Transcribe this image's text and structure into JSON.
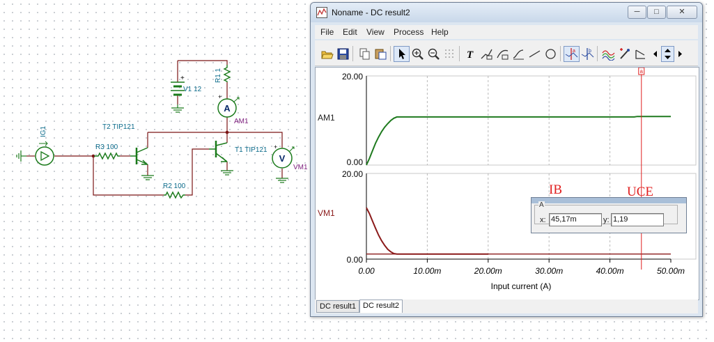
{
  "window": {
    "title": "Noname - DC result2",
    "minimize_glyph": "─",
    "maximize_glyph": "□",
    "close_glyph": "✕"
  },
  "menu": [
    "File",
    "Edit",
    "View",
    "Process",
    "Help"
  ],
  "toolbar_icons": [
    "open-icon",
    "save-icon",
    "copy-icon",
    "paste-icon",
    "pointer-icon",
    "zoom-in-icon",
    "zoom-out-icon",
    "grid-icon",
    "text-icon",
    "label-icon",
    "curve-label-icon",
    "curve-icon",
    "line-icon",
    "circle-icon",
    "cursor-a-icon",
    "cursor-b-icon",
    "waveform-icon",
    "marker-icon",
    "arrow-icon",
    "scroll-left-icon",
    "scroll-updown-icon",
    "scroll-right-icon"
  ],
  "schematic": {
    "v1": "V1 12",
    "r1": "R1 1",
    "am1_symbol": "A",
    "am1": "AM1",
    "ig1": "IG1",
    "t2": "T2 TIP121",
    "t1": "T1 TIP121",
    "r3": "R3 100",
    "r2": "R2 100",
    "vm1_symbol": "V",
    "vm1": "VM1",
    "plus": "+"
  },
  "chart_data": {
    "type": "line",
    "xlabel": "Input current (A)",
    "x_ticks": [
      "0.00",
      "10.00m",
      "20.00m",
      "30.00m",
      "40.00m",
      "50.00m"
    ],
    "xlim": [
      0,
      0.05
    ],
    "grid": true,
    "panels": [
      {
        "name": "AM1",
        "color": "#1e7a1e",
        "y_top_label": "20.00",
        "y_bottom_label": "0.00",
        "ylim": [
          0,
          20
        ],
        "series": [
          {
            "x": [
              0,
              0.0005,
              0.001,
              0.0015,
              0.002,
              0.0025,
              0.003,
              0.0035,
              0.004,
              0.0045,
              0.005,
              0.006,
              0.01,
              0.02,
              0.03,
              0.044,
              0.0445,
              0.05
            ],
            "y": [
              0,
              1.5,
              3.2,
              4.9,
              6.3,
              7.5,
              8.5,
              9.3,
              10.0,
              10.5,
              10.8,
              10.8,
              10.8,
              10.8,
              10.8,
              10.8,
              10.9,
              10.9
            ]
          }
        ]
      },
      {
        "name": "VM1",
        "color": "#8b1a1a",
        "y_top_label": "20.00",
        "y_bottom_label": "0.00",
        "ylim": [
          0,
          20
        ],
        "series": [
          {
            "name": "IB",
            "x": [
              0,
              0.0005,
              0.001,
              0.0015,
              0.002,
              0.0025,
              0.003,
              0.0035,
              0.004,
              0.0045,
              0.005,
              0.006,
              0.01,
              0.02
            ],
            "y": [
              12,
              10.6,
              8.9,
              7.2,
              5.6,
              4.3,
              3.2,
              2.3,
              1.7,
              1.3,
              1.19,
              1.19,
              1.19,
              1.19
            ]
          },
          {
            "name": "UCE",
            "x": [
              0,
              0.05
            ],
            "y": [
              1.19,
              1.19
            ]
          }
        ]
      }
    ],
    "annotations": [
      "IB",
      "UCE"
    ],
    "cursor": {
      "label": "a",
      "x": 0.04517
    }
  },
  "cursor_box": {
    "group": "A",
    "x_label": "x:",
    "x_value": "45,17m",
    "y_label": "y:",
    "y_value": "1,19"
  },
  "tabs": [
    "DC result1",
    "DC result2"
  ]
}
